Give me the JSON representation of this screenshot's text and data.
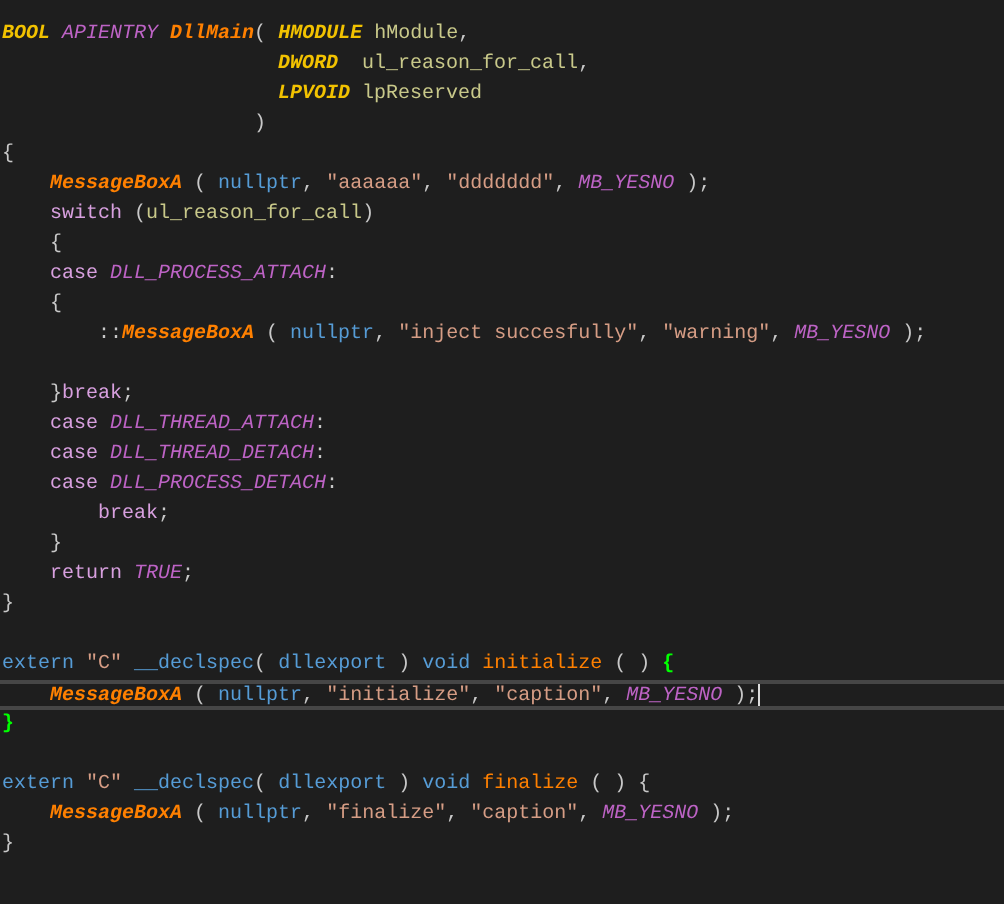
{
  "editor": {
    "lines": [
      {
        "current": false,
        "tokens": [
          {
            "kind": "type",
            "text": "BOOL "
          },
          {
            "kind": "macro",
            "text": "APIENTRY "
          },
          {
            "kind": "func",
            "text": "DllMain"
          },
          {
            "kind": "punct",
            "text": "( "
          },
          {
            "kind": "type",
            "text": "HMODULE "
          },
          {
            "kind": "var",
            "text": "hModule"
          },
          {
            "kind": "punct",
            "text": ","
          }
        ]
      },
      {
        "current": false,
        "tokens": [
          {
            "kind": "type",
            "text": "                       DWORD  "
          },
          {
            "kind": "var",
            "text": "ul_reason_for_call"
          },
          {
            "kind": "punct",
            "text": ","
          }
        ]
      },
      {
        "current": false,
        "tokens": [
          {
            "kind": "type",
            "text": "                       LPVOID "
          },
          {
            "kind": "var",
            "text": "lpReserved"
          }
        ]
      },
      {
        "current": false,
        "tokens": [
          {
            "kind": "punct",
            "text": "                     )"
          }
        ]
      },
      {
        "current": false,
        "tokens": [
          {
            "kind": "punct",
            "text": "{"
          }
        ]
      },
      {
        "current": false,
        "tokens": [
          {
            "kind": "func",
            "text": "    MessageBoxA"
          },
          {
            "kind": "punct",
            "text": " ( "
          },
          {
            "kind": "builtin",
            "text": "nullptr"
          },
          {
            "kind": "punct",
            "text": ", "
          },
          {
            "kind": "string",
            "text": "\"aaaaaa\""
          },
          {
            "kind": "punct",
            "text": ", "
          },
          {
            "kind": "string",
            "text": "\"ddddddd\""
          },
          {
            "kind": "punct",
            "text": ", "
          },
          {
            "kind": "macro",
            "text": "MB_YESNO"
          },
          {
            "kind": "punct",
            "text": " );"
          }
        ]
      },
      {
        "current": false,
        "tokens": [
          {
            "kind": "keyword",
            "text": "    switch"
          },
          {
            "kind": "punct",
            "text": " ("
          },
          {
            "kind": "var",
            "text": "ul_reason_for_call"
          },
          {
            "kind": "punct",
            "text": ")"
          }
        ]
      },
      {
        "current": false,
        "tokens": [
          {
            "kind": "punct",
            "text": "    {"
          }
        ]
      },
      {
        "current": false,
        "tokens": [
          {
            "kind": "keyword",
            "text": "    case "
          },
          {
            "kind": "macro",
            "text": "DLL_PROCESS_ATTACH"
          },
          {
            "kind": "punct",
            "text": ":"
          }
        ]
      },
      {
        "current": false,
        "tokens": [
          {
            "kind": "punct",
            "text": "    {"
          }
        ]
      },
      {
        "current": false,
        "tokens": [
          {
            "kind": "punct",
            "text": "        ::"
          },
          {
            "kind": "func",
            "text": "MessageBoxA"
          },
          {
            "kind": "punct",
            "text": " ( "
          },
          {
            "kind": "builtin",
            "text": "nullptr"
          },
          {
            "kind": "punct",
            "text": ", "
          },
          {
            "kind": "string",
            "text": "\"inject succesfully\""
          },
          {
            "kind": "punct",
            "text": ", "
          },
          {
            "kind": "string",
            "text": "\"warning\""
          },
          {
            "kind": "punct",
            "text": ", "
          },
          {
            "kind": "macro",
            "text": "MB_YESNO"
          },
          {
            "kind": "punct",
            "text": " );"
          }
        ]
      },
      {
        "current": false
      },
      {
        "current": false,
        "tokens": [
          {
            "kind": "punct",
            "text": "    }"
          },
          {
            "kind": "keyword",
            "text": "break"
          },
          {
            "kind": "punct",
            "text": ";"
          }
        ]
      },
      {
        "current": false,
        "tokens": [
          {
            "kind": "keyword",
            "text": "    case "
          },
          {
            "kind": "macro",
            "text": "DLL_THREAD_ATTACH"
          },
          {
            "kind": "punct",
            "text": ":"
          }
        ]
      },
      {
        "current": false,
        "tokens": [
          {
            "kind": "keyword",
            "text": "    case "
          },
          {
            "kind": "macro",
            "text": "DLL_THREAD_DETACH"
          },
          {
            "kind": "punct",
            "text": ":"
          }
        ]
      },
      {
        "current": false,
        "tokens": [
          {
            "kind": "keyword",
            "text": "    case "
          },
          {
            "kind": "macro",
            "text": "DLL_PROCESS_DETACH"
          },
          {
            "kind": "punct",
            "text": ":"
          }
        ]
      },
      {
        "current": false,
        "tokens": [
          {
            "kind": "keyword",
            "text": "        break"
          },
          {
            "kind": "punct",
            "text": ";"
          }
        ]
      },
      {
        "current": false,
        "tokens": [
          {
            "kind": "punct",
            "text": "    }"
          }
        ]
      },
      {
        "current": false,
        "tokens": [
          {
            "kind": "keyword",
            "text": "    return "
          },
          {
            "kind": "macro",
            "text": "TRUE"
          },
          {
            "kind": "punct",
            "text": ";"
          }
        ]
      },
      {
        "current": false,
        "tokens": [
          {
            "kind": "punct",
            "text": "}"
          }
        ]
      },
      {
        "current": false
      },
      {
        "current": false,
        "tokens": [
          {
            "kind": "builtin",
            "text": "extern "
          },
          {
            "kind": "string",
            "text": "\"C\" "
          },
          {
            "kind": "builtin",
            "text": "__declspec"
          },
          {
            "kind": "punct",
            "text": "( "
          },
          {
            "kind": "builtin",
            "text": "dllexport"
          },
          {
            "kind": "punct",
            "text": " ) "
          },
          {
            "kind": "builtin",
            "text": "void "
          },
          {
            "kind": "name",
            "text": "initialize"
          },
          {
            "kind": "punct",
            "text": " ( ) "
          },
          {
            "kind": "brace-match",
            "text": "{"
          }
        ]
      },
      {
        "current": true,
        "tokens": [
          {
            "kind": "func",
            "text": "    MessageBoxA"
          },
          {
            "kind": "punct",
            "text": " ( "
          },
          {
            "kind": "builtin",
            "text": "nullptr"
          },
          {
            "kind": "punct",
            "text": ", "
          },
          {
            "kind": "string",
            "text": "\"initialize\""
          },
          {
            "kind": "punct",
            "text": ", "
          },
          {
            "kind": "string",
            "text": "\"caption\""
          },
          {
            "kind": "punct",
            "text": ", "
          },
          {
            "kind": "macro",
            "text": "MB_YESNO"
          },
          {
            "kind": "punct",
            "text": " );"
          }
        ]
      },
      {
        "current": false,
        "tokens": [
          {
            "kind": "brace-match",
            "text": "}"
          }
        ]
      },
      {
        "current": false
      },
      {
        "current": false,
        "tokens": [
          {
            "kind": "builtin",
            "text": "extern "
          },
          {
            "kind": "string",
            "text": "\"C\" "
          },
          {
            "kind": "builtin",
            "text": "__declspec"
          },
          {
            "kind": "punct",
            "text": "( "
          },
          {
            "kind": "builtin",
            "text": "dllexport"
          },
          {
            "kind": "punct",
            "text": " ) "
          },
          {
            "kind": "builtin",
            "text": "void "
          },
          {
            "kind": "name",
            "text": "finalize"
          },
          {
            "kind": "punct",
            "text": " ( ) {"
          }
        ]
      },
      {
        "current": false,
        "tokens": [
          {
            "kind": "func",
            "text": "    MessageBoxA"
          },
          {
            "kind": "punct",
            "text": " ( "
          },
          {
            "kind": "builtin",
            "text": "nullptr"
          },
          {
            "kind": "punct",
            "text": ", "
          },
          {
            "kind": "string",
            "text": "\"finalize\""
          },
          {
            "kind": "punct",
            "text": ", "
          },
          {
            "kind": "string",
            "text": "\"caption\""
          },
          {
            "kind": "punct",
            "text": ", "
          },
          {
            "kind": "macro",
            "text": "MB_YESNO"
          },
          {
            "kind": "punct",
            "text": " );"
          }
        ]
      },
      {
        "current": false,
        "tokens": [
          {
            "kind": "punct",
            "text": "}"
          }
        ]
      }
    ]
  }
}
